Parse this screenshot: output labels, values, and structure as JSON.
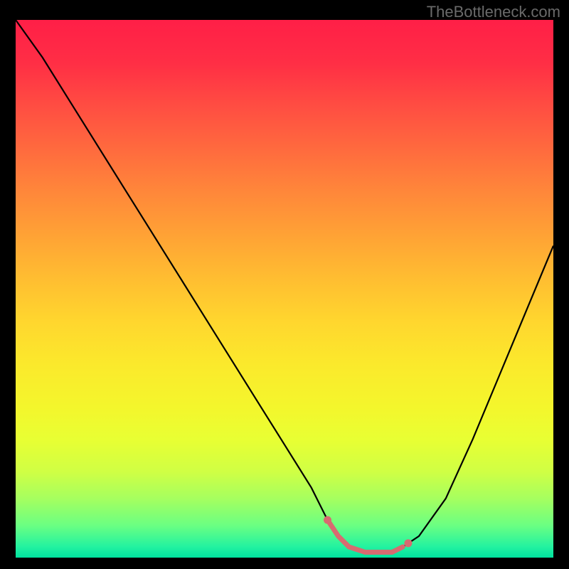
{
  "watermark": "TheBottleneck.com",
  "chart_data": {
    "type": "line",
    "title": "",
    "xlabel": "",
    "ylabel": "",
    "xlim": [
      0,
      100
    ],
    "ylim": [
      0,
      100
    ],
    "grid": false,
    "series": [
      {
        "name": "bottleneck-curve",
        "x": [
          0,
          5,
          10,
          15,
          20,
          25,
          30,
          35,
          40,
          45,
          50,
          55,
          58,
          60,
          62,
          65,
          68,
          70,
          72,
          75,
          80,
          85,
          90,
          95,
          100
        ],
        "y": [
          100,
          93,
          85,
          77,
          69,
          61,
          53,
          45,
          37,
          29,
          21,
          13,
          7,
          4,
          2,
          1,
          1,
          1,
          2,
          4,
          11,
          22,
          34,
          46,
          58
        ]
      }
    ],
    "markers": [
      {
        "name": "marker-start",
        "x": 58,
        "y": 3,
        "color": "#d86b70"
      },
      {
        "name": "marker-end",
        "x": 73,
        "y": 3,
        "color": "#d86b70"
      }
    ],
    "highlight_segment": {
      "name": "optimal-range",
      "x_start": 58,
      "x_end": 73,
      "color": "#d86b70"
    },
    "background_gradient": {
      "top": "#ff1f47",
      "mid": "#ffd62e",
      "bottom": "#00e29f"
    }
  }
}
